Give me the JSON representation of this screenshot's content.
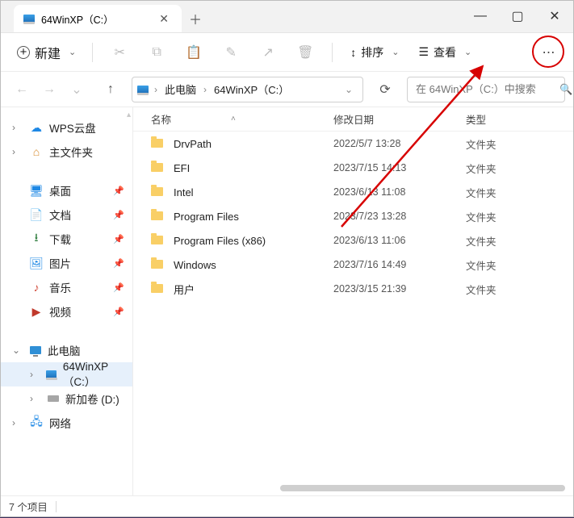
{
  "tab": {
    "title": "64WinXP（C:）"
  },
  "toolbar": {
    "new": "新建",
    "sort": "排序",
    "view": "查看"
  },
  "breadcrumb": {
    "seg1": "此电脑",
    "seg2": "64WinXP（C:）"
  },
  "search": {
    "placeholder": "在 64WinXP（C:）中搜索"
  },
  "sidebar": {
    "quick": [
      {
        "label": "WPS云盘",
        "iconClass": "cloud-ico",
        "glyph": "☁"
      },
      {
        "label": "主文件夹",
        "iconClass": "home-ico",
        "glyph": "⌂"
      }
    ],
    "pinned": [
      {
        "label": "桌面",
        "iconClass": "desk-ico",
        "glyph": "🖥"
      },
      {
        "label": "文档",
        "iconClass": "doc-ico",
        "glyph": "📄"
      },
      {
        "label": "下载",
        "iconClass": "dl-ico",
        "glyph": "⭳"
      },
      {
        "label": "图片",
        "iconClass": "pic-ico",
        "glyph": "🖼"
      },
      {
        "label": "音乐",
        "iconClass": "mus-ico",
        "glyph": "♪"
      },
      {
        "label": "视频",
        "iconClass": "vid-ico",
        "glyph": "▶"
      }
    ],
    "thisPc": "此电脑",
    "drives": [
      {
        "label": "64WinXP（C:）",
        "selected": true
      },
      {
        "label": "新加卷 (D:)",
        "selected": false
      }
    ],
    "network": "网络"
  },
  "columns": {
    "name": "名称",
    "date": "修改日期",
    "type": "类型"
  },
  "files": [
    {
      "name": "DrvPath",
      "date": "2022/5/7 13:28",
      "type": "文件夹"
    },
    {
      "name": "EFI",
      "date": "2023/7/15 14:13",
      "type": "文件夹"
    },
    {
      "name": "Intel",
      "date": "2023/6/13 11:08",
      "type": "文件夹"
    },
    {
      "name": "Program Files",
      "date": "2023/7/23 13:28",
      "type": "文件夹"
    },
    {
      "name": "Program Files (x86)",
      "date": "2023/6/13 11:06",
      "type": "文件夹"
    },
    {
      "name": "Windows",
      "date": "2023/7/16 14:49",
      "type": "文件夹"
    },
    {
      "name": "用户",
      "date": "2023/3/15 21:39",
      "type": "文件夹"
    }
  ],
  "status": {
    "count": "7 个项目"
  },
  "annotation": {
    "color": "#d70000"
  }
}
